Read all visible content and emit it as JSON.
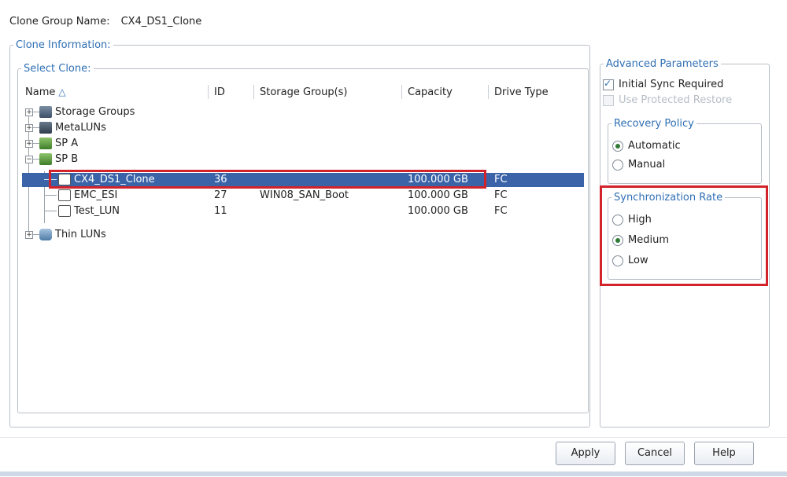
{
  "header": {
    "label": "Clone Group Name:",
    "value": "CX4_DS1_Clone"
  },
  "groups": {
    "clone_info": "Clone Information:",
    "select_clone": "Select Clone:",
    "advanced": "Advanced Parameters",
    "recovery": "Recovery Policy",
    "sync": "Synchronization Rate"
  },
  "table": {
    "columns": [
      "Name",
      "ID",
      "Storage Group(s)",
      "Capacity",
      "Drive Type"
    ],
    "rows": [
      {
        "name": "Storage Groups",
        "id": "",
        "sg": "",
        "cap": "",
        "drive": ""
      },
      {
        "name": "MetaLUNs",
        "id": "",
        "sg": "",
        "cap": "",
        "drive": ""
      },
      {
        "name": "SP A",
        "id": "",
        "sg": "",
        "cap": "",
        "drive": ""
      },
      {
        "name": "SP B",
        "id": "",
        "sg": "",
        "cap": "",
        "drive": ""
      },
      {
        "name": "CX4_DS1_Clone",
        "id": "36",
        "sg": "",
        "cap": "100.000 GB",
        "drive": "FC"
      },
      {
        "name": "EMC_ESI",
        "id": "27",
        "sg": "WIN08_SAN_Boot",
        "cap": "100.000 GB",
        "drive": "FC"
      },
      {
        "name": "Test_LUN",
        "id": "11",
        "sg": "",
        "cap": "100.000 GB",
        "drive": "FC"
      },
      {
        "name": "Thin LUNs",
        "id": "",
        "sg": "",
        "cap": "",
        "drive": ""
      }
    ]
  },
  "advanced": {
    "initial_sync": "Initial Sync Required",
    "use_protected": "Use Protected Restore"
  },
  "recovery": {
    "auto": "Automatic",
    "manual": "Manual"
  },
  "sync": {
    "high": "High",
    "medium": "Medium",
    "low": "Low"
  },
  "buttons": {
    "apply": "Apply",
    "cancel": "Cancel",
    "help": "Help"
  },
  "colors": {
    "accent": "#2f6fb4",
    "selection": "#3b64a8",
    "highlight": "#d2232a"
  }
}
